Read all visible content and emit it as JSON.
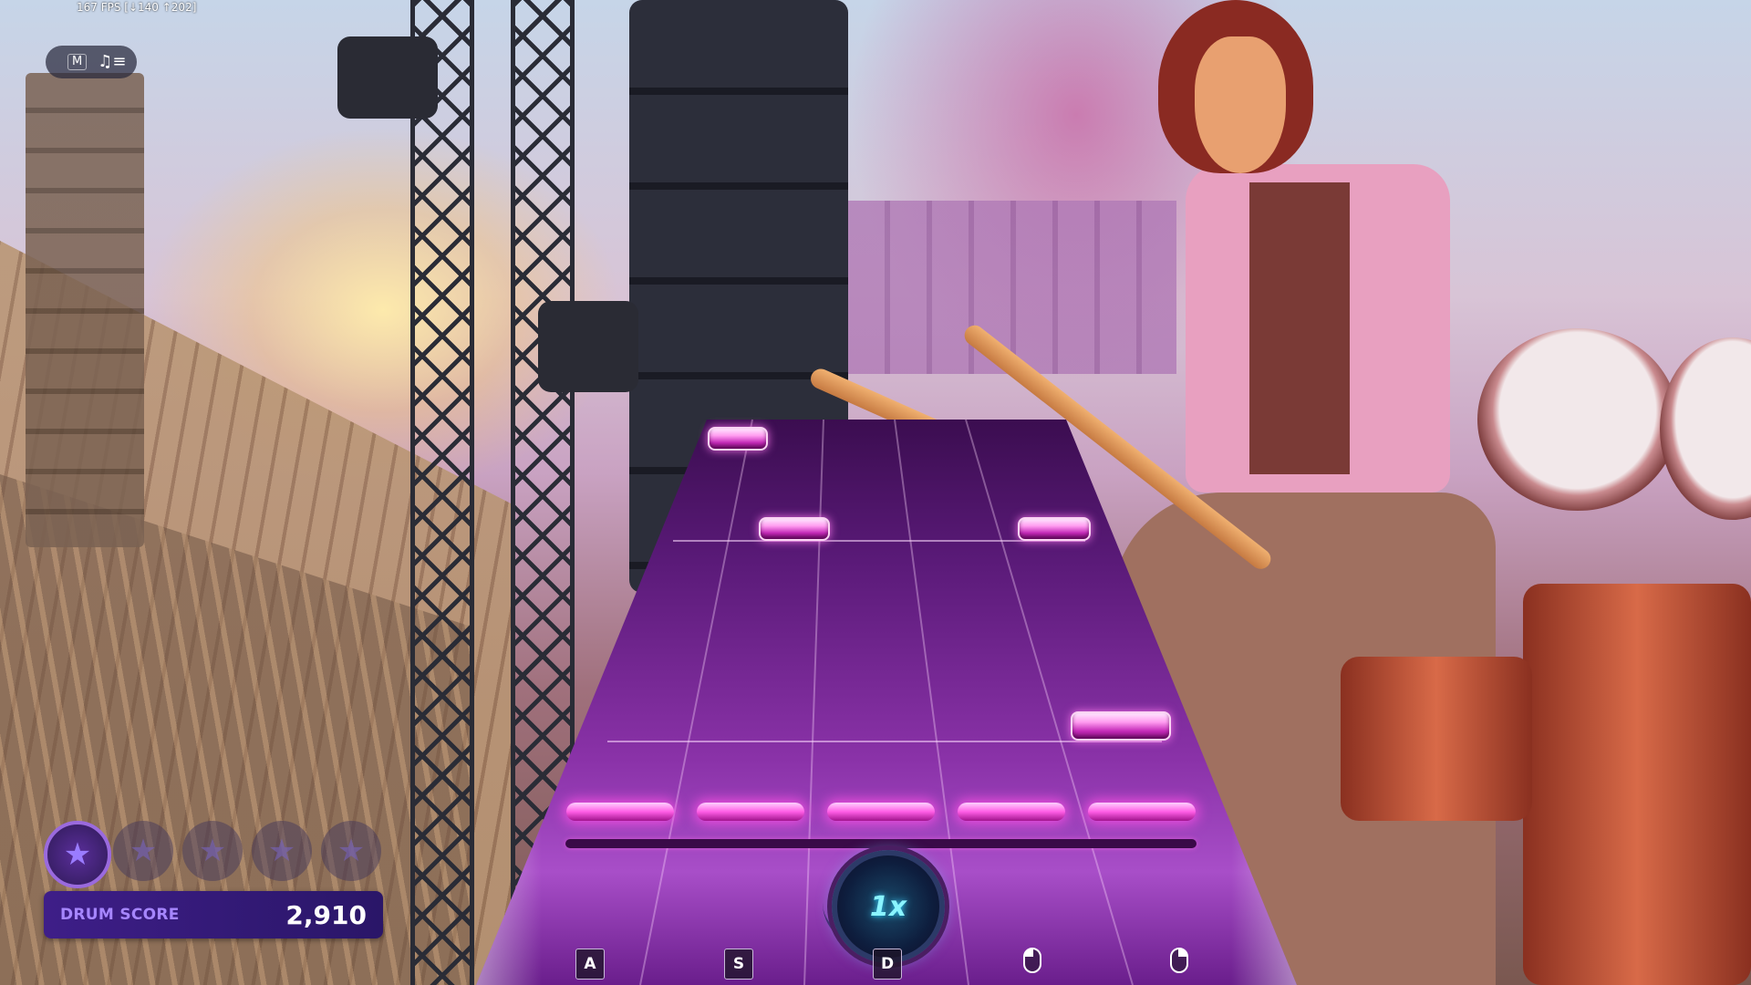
{
  "hud": {
    "fps_counter": "167 FPS [↓140 ↑202]",
    "mode_key": "M",
    "music_icon": "music-notes-icon"
  },
  "stars": {
    "total": 5,
    "earned": 1,
    "icon": "star-icon"
  },
  "score": {
    "label": "DRUM SCORE",
    "value": "2,910"
  },
  "highway": {
    "multiplier": "1x",
    "lanes": 5,
    "lane_keys": [
      "A",
      "S",
      "D",
      "left-mouse-icon",
      "right-mouse-icon"
    ],
    "colors": {
      "track": "#7a2a9c",
      "gem": "#ff5ee6",
      "multiplier_text": "#8af4ff"
    }
  },
  "colors": {
    "score_panel": "#3e1e88",
    "score_label": "#a686ff"
  }
}
